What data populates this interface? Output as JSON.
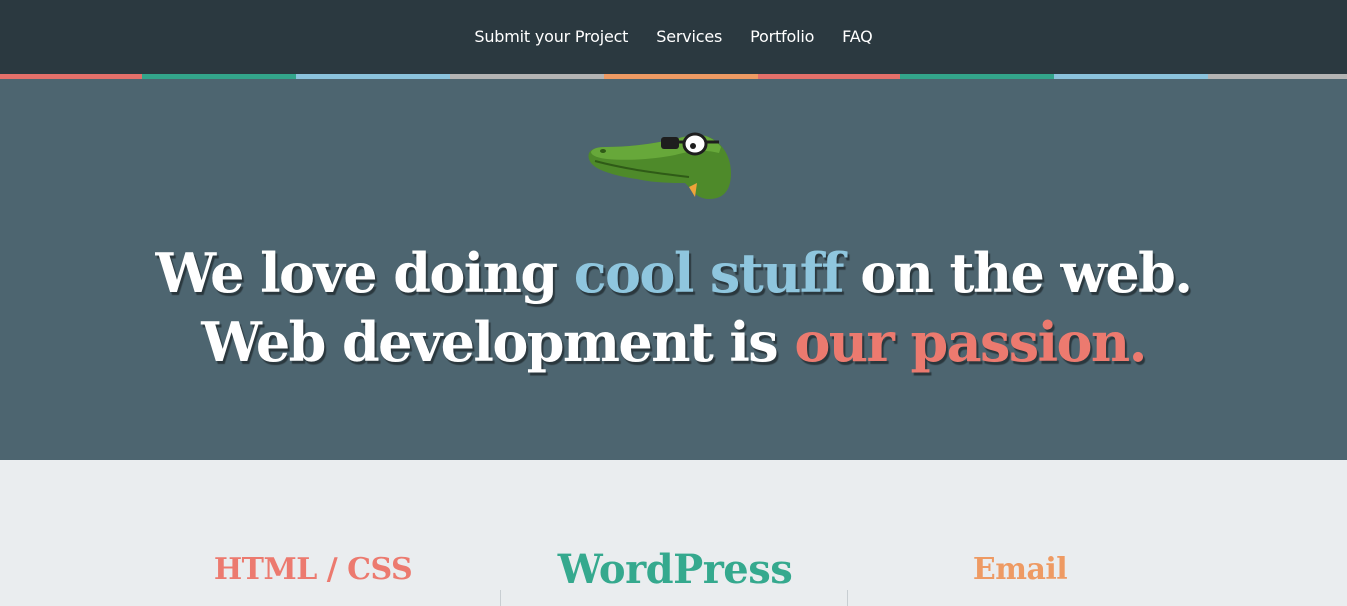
{
  "nav": {
    "items": [
      {
        "label": "Submit your Project"
      },
      {
        "label": "Services"
      },
      {
        "label": "Portfolio"
      },
      {
        "label": "FAQ"
      }
    ]
  },
  "stripe_colors": [
    "#e4706a",
    "#33a58b",
    "#8bc3dd",
    "#b4b4b4",
    "#ee9a63",
    "#e4706a",
    "#33a58b",
    "#8bc3dd",
    "#b4b4b4"
  ],
  "hero": {
    "line1_a": "We love doing ",
    "line1_b": "cool stuff",
    "line1_c": " on the web.",
    "line2_a": "Web development is ",
    "line2_b": "our passion.",
    "accent_blue": "#8fc6de",
    "accent_red": "#ec7a6f",
    "mascot": "crocodile-with-glasses-icon"
  },
  "services": {
    "items": [
      {
        "label": "HTML / CSS",
        "color": "#ec7a6f"
      },
      {
        "label": "WordPress",
        "color": "#35a98e"
      },
      {
        "label": "Email",
        "color": "#ee9a63"
      }
    ]
  }
}
